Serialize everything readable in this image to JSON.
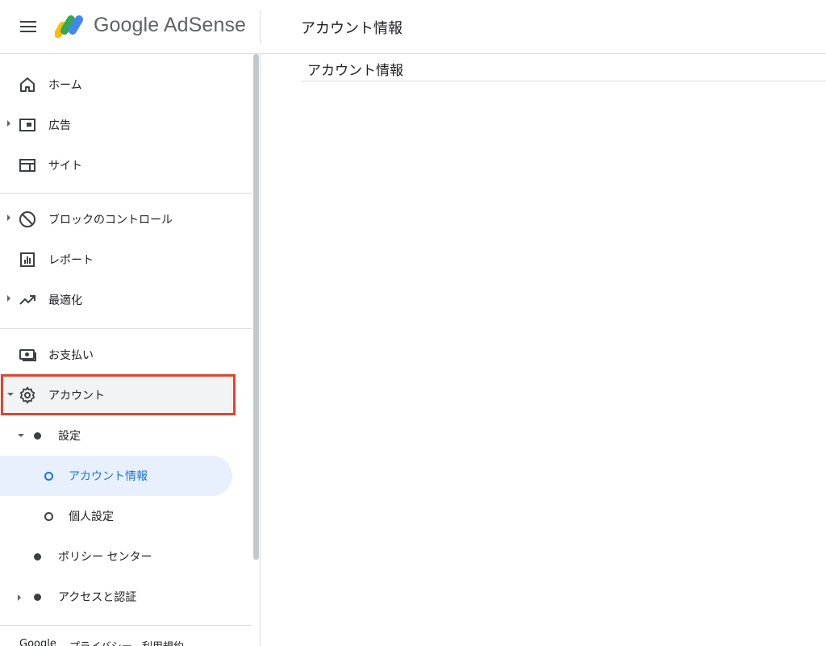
{
  "header": {
    "menu_icon": "hamburger-menu-icon",
    "logo_icon": "adsense-logo-icon",
    "app_name": "Google AdSense",
    "page_title": "アカウント情報"
  },
  "sidebar": {
    "items": [
      {
        "label": "ホーム",
        "icon": "home-icon"
      },
      {
        "label": "広告",
        "icon": "ads-icon"
      },
      {
        "label": "サイト",
        "icon": "sites-icon"
      },
      {
        "label": "ブロックのコントロール",
        "icon": "block-icon"
      },
      {
        "label": "レポート",
        "icon": "report-icon"
      },
      {
        "label": "最適化",
        "icon": "trending-up-icon"
      },
      {
        "label": "お支払い",
        "icon": "payments-icon"
      },
      {
        "label": "アカウント",
        "icon": "gear-icon"
      }
    ],
    "account_sub": {
      "settings": "設定",
      "account_info": "アカウント情報",
      "personal_settings": "個人設定",
      "policy_center": "ポリシー センター",
      "access_auth": "アクセスと認証"
    },
    "footer": {
      "google": "Google",
      "privacy": "プライバシー",
      "terms": "利用規約"
    }
  },
  "main": {
    "heading": "アカウント情報"
  },
  "colors": {
    "accent": "#1a73e8",
    "highlight_border": "#e8412a",
    "active_bg": "#e8f0fe"
  }
}
